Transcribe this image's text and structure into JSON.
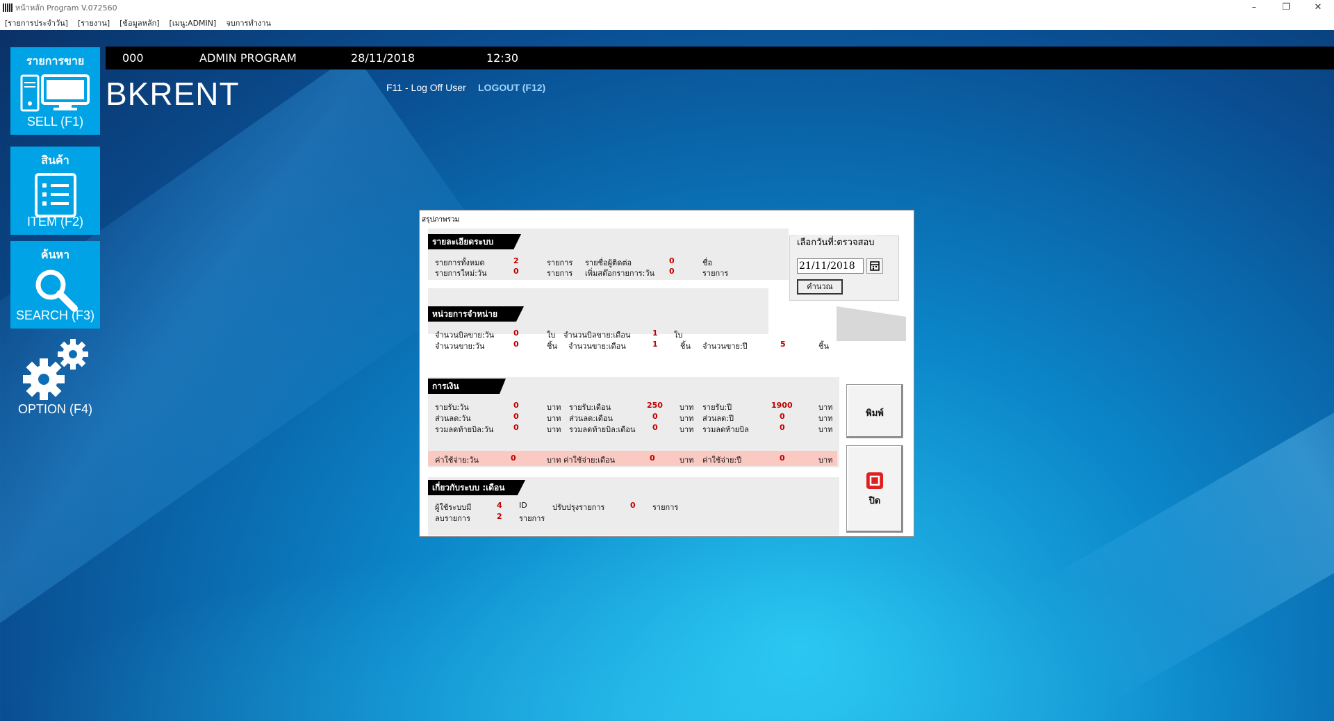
{
  "window": {
    "title": "หน้าหลัก Program V.072560",
    "minimize": "–",
    "restore": "❐",
    "close": "✕"
  },
  "menu": [
    "[รายการประจำวัน]",
    "[รายงาน]",
    "[ข้อมูลหลัก]",
    "[เมนู:ADMIN]",
    "จบการทำงาน"
  ],
  "header": {
    "code": "000",
    "user": "ADMIN PROGRAM",
    "date": "28/11/2018",
    "time": "12:30",
    "company": "BKRENT",
    "logoff": "F11 - Log Off User",
    "logout": "LOGOUT (F12)"
  },
  "tiles": {
    "sell": {
      "title": "รายการขาย",
      "label": "SELL (F1)"
    },
    "item": {
      "title": "สินค้า",
      "label": "ITEM (F2)"
    },
    "search": {
      "title": "ค้นหา",
      "label": "SEARCH (F3)"
    },
    "option": {
      "label": "OPTION (F4)"
    }
  },
  "dialog": {
    "title": "สรุปภาพรวม",
    "system": {
      "tab": "รายละเอียดระบบ",
      "total_items_label": "รายการทั้งหมด",
      "total_items": "2",
      "total_items_unit": "รายการ",
      "contacts_label": "รายชื่อผู้ติดต่อ",
      "contacts": "0",
      "contacts_unit": "ชื่อ",
      "new_items_label": "รายการใหม่:วัน",
      "new_items": "0",
      "new_items_unit": "รายการ",
      "added_label": "เพิ่มสต๊อกรายการ:วัน",
      "added": "0",
      "added_unit": "รายการ"
    },
    "sales": {
      "tab": "หน่วยการจำหน่าย",
      "bills_day_label": "จำนวนบิลขาย:วัน",
      "bills_day": "0",
      "bills_day_unit": "ใบ",
      "bills_month_label": "จำนวนบิลขาย:เดือน",
      "bills_month": "1",
      "bills_month_unit": "ใบ",
      "qty_day_label": "จำนวนขาย:วัน",
      "qty_day": "0",
      "qty_day_unit": "ชิ้น",
      "qty_month_label": "จำนวนขาย:เดือน",
      "qty_month": "1",
      "qty_month_unit": "ชิ้น",
      "qty_year_label": "จำนวนขาย:ปี",
      "qty_year": "5",
      "qty_year_unit": "ชิ้น"
    },
    "finance": {
      "tab": "การเงิน",
      "inc_day_label": "รายรับ:วัน",
      "inc_day": "0",
      "inc_day_unit": "บาท",
      "inc_month_label": "รายรับ:เดือน",
      "inc_month": "250",
      "inc_month_unit": "บาท",
      "inc_year_label": "รายรับ:ปี",
      "inc_year": "1900",
      "inc_year_unit": "บาท",
      "disc_day_label": "ส่วนลด:วัน",
      "disc_day": "0",
      "disc_day_unit": "บาท",
      "disc_month_label": "ส่วนลด:เดือน",
      "disc_month": "0",
      "disc_month_unit": "บาท",
      "disc_year_label": "ส่วนลด:ปี",
      "disc_year": "0",
      "disc_year_unit": "บาท",
      "billdisc_day_label": "รวมลดท้ายบิล:วัน",
      "billdisc_day": "0",
      "billdisc_day_unit": "บาท",
      "billdisc_month_label": "รวมลดท้ายบิล:เดือน",
      "billdisc_month": "0",
      "billdisc_month_unit": "บาท",
      "billdisc_year_label": "รวมลดท้ายบิล",
      "billdisc_year": "0",
      "billdisc_year_unit": "บาท",
      "exp_day_label": "ค่าใช้จ่าย:วัน",
      "exp_day": "0",
      "exp_day_unit": "บาท",
      "exp_month_label": "ค่าใช้จ่าย:เดือน",
      "exp_month": "0",
      "exp_month_unit": "บาท",
      "exp_year_label": "ค่าใช้จ่าย:ปี",
      "exp_year": "0",
      "exp_year_unit": "บาท"
    },
    "about": {
      "tab": "เกี่ยวกับระบบ :เดือน",
      "users_label": "ผู้ใช้ระบบมี",
      "users": "4",
      "users_unit": "ID",
      "updated_label": "ปรับปรุงรายการ",
      "updated": "0",
      "updated_unit": "รายการ",
      "deleted_label": "ลบรายการ",
      "deleted": "2",
      "deleted_unit": "รายการ"
    },
    "date_select": {
      "legend": "เลือกวันที่:ตรวจสอบ",
      "value": "21/11/2018",
      "calc_button": "คำนวณ"
    },
    "print_button": "พิมพ์",
    "close_button": "ปิด"
  },
  "colors": {
    "tile": "#00a3e6",
    "value_red": "#c00000",
    "expense_bg": "#f9c9c2"
  }
}
